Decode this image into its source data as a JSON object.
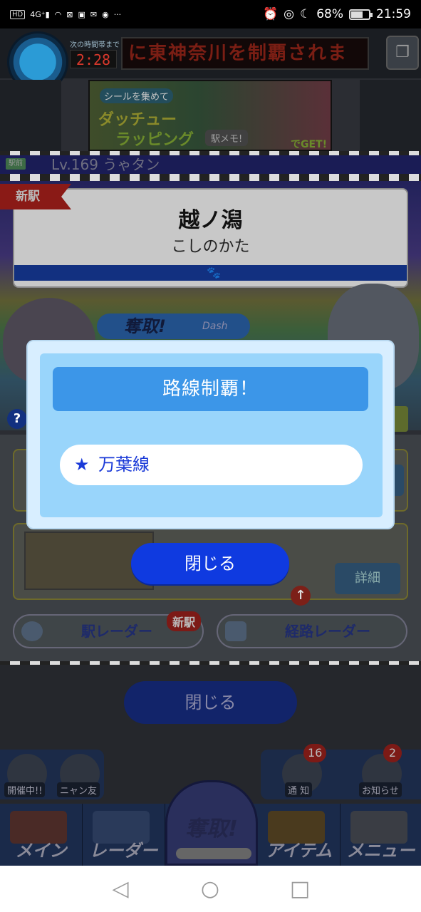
{
  "status_bar": {
    "left_indicators": [
      "HD",
      "4G+",
      "signal",
      "wifi-off",
      "notify",
      "alert",
      "mail",
      "chat",
      "..."
    ],
    "battery_percent": "68%",
    "battery_level": 0.68,
    "time": "21:59"
  },
  "game": {
    "timer_label": "次の時間帯まで",
    "timer": "2:28",
    "led_message": "に東神奈川を制覇されま",
    "banner": {
      "line1": "シールを集めて",
      "line2": "ダッチュー",
      "line3": "ラッピング",
      "memo": "駅メモ!",
      "get": "でGET!"
    },
    "level_tag": "駅前",
    "level_text": "Lv.169 うゃタン",
    "new_tag": "新駅",
    "station_name": "越ノ潟",
    "station_kana": "こしのかた",
    "dash_main": "奪取!",
    "dash_sub": "Dash",
    "help": "?",
    "detail_button": "詳細",
    "station_radar": "駅レーダー",
    "station_radar_badge": "新駅",
    "route_radar": "経路レーダー",
    "close_dim": "閉じる",
    "trays": {
      "event": "開催中!!",
      "friends": "ニャン友",
      "notice": "通 知",
      "notice_count": "16",
      "news": "お知らせ",
      "news_count": "2"
    },
    "nav": {
      "main": "メイン",
      "radar": "レーダー",
      "dash": "奪取!",
      "item": "アイテム",
      "menu": "メニュー"
    }
  },
  "modal": {
    "title": "路線制覇！",
    "route_icon": "star-icon",
    "route_name": "万葉線",
    "close_label": "閉じる"
  },
  "system_nav": {
    "back": "◁",
    "home": "○",
    "recents": "□"
  },
  "colors": {
    "modal_bg": "#d8eeff",
    "modal_inner": "#99d5fb",
    "title_bar": "#3c96e8",
    "close_button": "#0f3ae0",
    "route_text": "#1a3ad8"
  }
}
